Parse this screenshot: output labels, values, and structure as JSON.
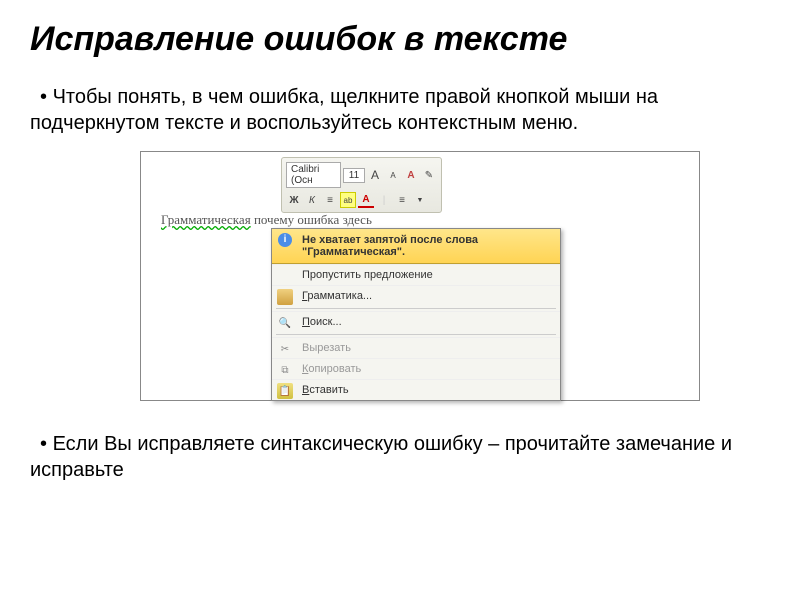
{
  "title": "Исправление ошибок в тексте",
  "bullet1": "Чтобы понять, в чем ошибка, щелкните правой кнопкой мыши на подчеркнутом тексте и воспользуйтесь контекстным меню.",
  "bullet2": "Если Вы исправляете синтаксическую ошибку – прочитайте замечание и исправьте",
  "toolbar": {
    "font": "Calibri (Осн",
    "size": "11",
    "grow": "A",
    "shrink": "A",
    "styles": "A",
    "brush": "✎",
    "bold": "Ж",
    "italic": "К",
    "align_center": "≡",
    "highlight": "ab",
    "font_color": "A",
    "bullets": "≡"
  },
  "doc": {
    "word1": "Грамматическая",
    "word2": " почему ошибка здесь"
  },
  "menu": {
    "header_icon": "i",
    "header": "Не хватает запятой после слова \"Грамматическая\".",
    "skip": "Пропустить предложение",
    "grammar": "Грамматика...",
    "search": "Поиск...",
    "cut": "Вырезать",
    "copy": "Копировать",
    "paste": "Вставить"
  }
}
